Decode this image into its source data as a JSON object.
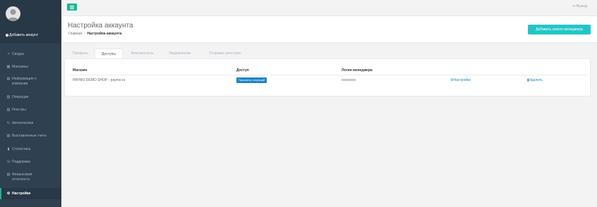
{
  "sidebar": {
    "add_account": "Добавить аккаунт",
    "items": [
      {
        "icon": "line-chart-icon",
        "glyph": "↗",
        "label": "Сводка"
      },
      {
        "icon": "shop-icon",
        "glyph": "▦",
        "label": "Магазины"
      },
      {
        "icon": "info-file-icon",
        "glyph": "▤",
        "label": "Информация о",
        "label2": "компании"
      },
      {
        "icon": "operations-icon",
        "glyph": "▥",
        "label": "Операции"
      },
      {
        "icon": "registry-icon",
        "glyph": "▧",
        "label": "Реестры"
      },
      {
        "icon": "auto-payment-icon",
        "glyph": "↻",
        "label": "Автоплатежи"
      },
      {
        "icon": "invoice-icon",
        "glyph": "▤",
        "label": "Выставленные счета"
      },
      {
        "icon": "statistics-icon",
        "glyph": "▮",
        "label": "Статистика"
      },
      {
        "icon": "phone-icon",
        "glyph": "☏",
        "label": "Поддержка"
      },
      {
        "icon": "finance-report-icon",
        "glyph": "▤",
        "label": "Финансовая",
        "label2": "отчетность"
      },
      {
        "icon": "gear-icon",
        "glyph": "⚙",
        "label": "Настройки",
        "active": true
      }
    ]
  },
  "topbar": {
    "logout": "Выход"
  },
  "heading": {
    "title": "Настройка аккаунта",
    "breadcrumb_home": "Главная",
    "breadcrumb_current": "Настройка аккаунта",
    "add_manager": "Добавить нового менеджера"
  },
  "tabs": [
    {
      "label": "Профиль"
    },
    {
      "label": "Доступы",
      "active": true
    },
    {
      "label": "Безопасность"
    },
    {
      "label": "Уведомления"
    },
    {
      "label": "Отправка реестров"
    }
  ],
  "table": {
    "headers": {
      "shop": "Магазин",
      "access": "Доступ",
      "login": "Логин менеджера"
    },
    "rows": [
      {
        "shop": "PAYMO DEMO SHOP - paymo.ru",
        "access": "Просмотр операций",
        "login": "xxxxxxxx",
        "settings": "Настройки",
        "delete": "Удалить"
      }
    ]
  },
  "colors": {
    "sidebar": "#2f4050",
    "primary": "#1ab394",
    "info": "#23c6c8",
    "link": "#1c84c6"
  }
}
